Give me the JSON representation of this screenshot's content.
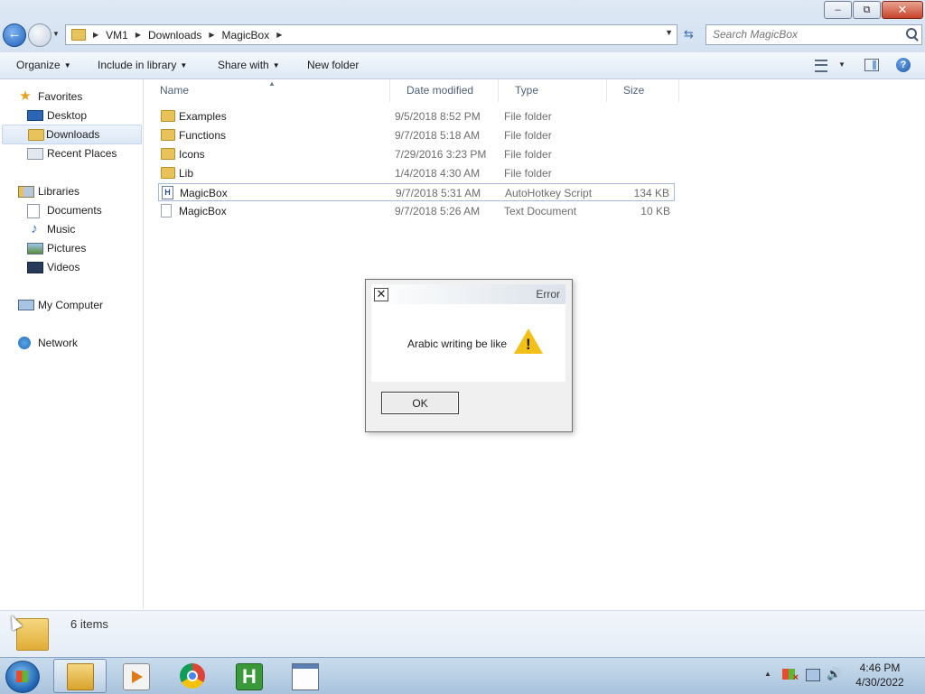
{
  "window": {
    "caption_buttons": [
      {
        "name": "minimize",
        "glyph": "–"
      },
      {
        "name": "restore",
        "glyph": "⧉"
      },
      {
        "name": "close",
        "glyph": "✕"
      }
    ]
  },
  "address": {
    "breadcrumbs": [
      "VM1",
      "Downloads",
      "MagicBox"
    ]
  },
  "search": {
    "placeholder": "Search MagicBox"
  },
  "toolbar": {
    "organize": "Organize",
    "include_in_library": "Include in library",
    "share_with": "Share with",
    "new_folder": "New folder"
  },
  "nav": {
    "favorites": "Favorites",
    "desktop": "Desktop",
    "downloads": "Downloads",
    "recent_places": "Recent Places",
    "libraries": "Libraries",
    "documents": "Documents",
    "music": "Music",
    "pictures": "Pictures",
    "videos": "Videos",
    "my_computer": "My Computer",
    "network": "Network",
    "selected": "Downloads"
  },
  "columns": {
    "name": "Name",
    "date_modified": "Date modified",
    "type": "Type",
    "size": "Size"
  },
  "files": [
    {
      "name": "Examples",
      "date": "9/5/2018 8:52 PM",
      "type": "File folder",
      "size": "",
      "icon": "folder-icon"
    },
    {
      "name": "Functions",
      "date": "9/7/2018 5:18 AM",
      "type": "File folder",
      "size": "",
      "icon": "folder-icon"
    },
    {
      "name": "Icons",
      "date": "7/29/2016 3:23 PM",
      "type": "File folder",
      "size": "",
      "icon": "folder-icon"
    },
    {
      "name": "Lib",
      "date": "1/4/2018 4:30 AM",
      "type": "File folder",
      "size": "",
      "icon": "folder-icon"
    },
    {
      "name": "MagicBox",
      "date": "9/7/2018 5:31 AM",
      "type": "AutoHotkey Script",
      "size": "134 KB",
      "icon": "ahk-script-icon"
    },
    {
      "name": "MagicBox",
      "date": "9/7/2018 5:26 AM",
      "type": "Text Document",
      "size": "10 KB",
      "icon": "text-document-icon"
    }
  ],
  "details": {
    "item_count": "6 items"
  },
  "dialog": {
    "title": "Error",
    "message": "Arabic writing be like",
    "close_glyph": "✕",
    "ok_label": "OK",
    "icon": "warning-icon"
  },
  "taskbar": {
    "apps": [
      "windows-explorer",
      "media-player",
      "chrome",
      "autohotkey",
      "window"
    ],
    "active_app": "windows-explorer",
    "time": "4:46 PM",
    "date": "4/30/2022"
  },
  "colors": {
    "selection_border": "#a7bcd8",
    "folder": "#e8c25a",
    "warning": "#f2c018",
    "taskbar": "#b9d0e6"
  }
}
